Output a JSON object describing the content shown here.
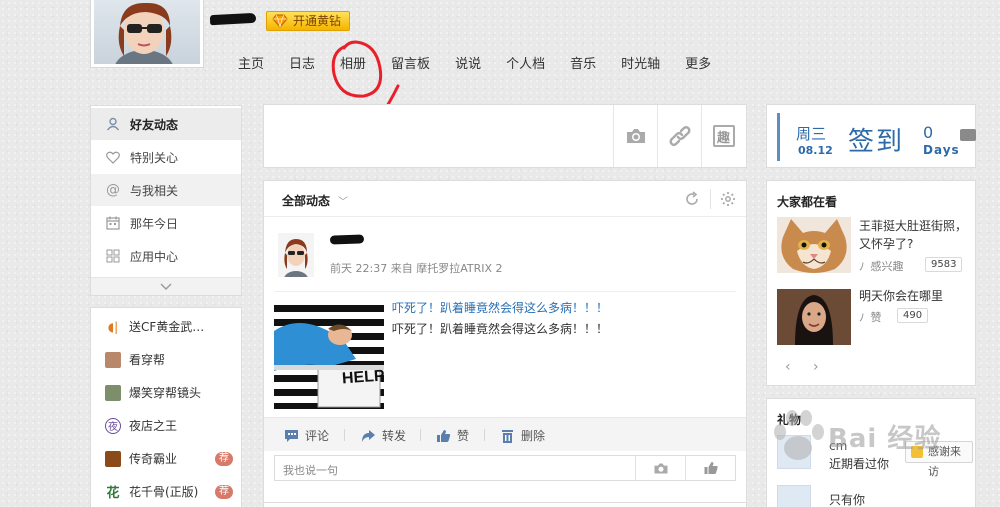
{
  "header": {
    "vip_label": "开通黄钻",
    "nav": [
      "主页",
      "日志",
      "相册",
      "留言板",
      "说说",
      "个人档",
      "音乐",
      "时光轴",
      "更多"
    ]
  },
  "sidebar": {
    "items": [
      {
        "label": "好友动态",
        "icon": "user-icon"
      },
      {
        "label": "特别关心",
        "icon": "heart-icon"
      },
      {
        "label": "与我相关",
        "icon": "at-icon"
      },
      {
        "label": "那年今日",
        "icon": "calendar-icon"
      },
      {
        "label": "应用中心",
        "icon": "grid-icon"
      }
    ],
    "apps": [
      {
        "label": "送CF黄金武…",
        "icon": "audio-icon",
        "badge": ""
      },
      {
        "label": "看穿帮",
        "icon": "app-avatar-icon",
        "badge": ""
      },
      {
        "label": "爆笑穿帮镜头",
        "icon": "app-photo-icon",
        "badge": ""
      },
      {
        "label": "夜店之王",
        "icon": "nightclub-icon",
        "badge": ""
      },
      {
        "label": "传奇霸业",
        "icon": "legend-icon",
        "badge": "荐"
      },
      {
        "label": "花千骨(正版)",
        "icon": "flower-icon",
        "badge": "荐"
      }
    ]
  },
  "compose": {
    "buttons": [
      "camera-icon",
      "link-icon",
      "fun-icon"
    ],
    "fun_label": "趣"
  },
  "feed": {
    "filter": "全部动态",
    "post": {
      "meta": "前天 22:37 来自 摩托罗拉ATRIX 2",
      "title": "吓死了！趴着睡竟然会得这么多病！！！",
      "summary": "吓死了！趴着睡竟然会得这么多病！！！",
      "image_sign": "HELP"
    },
    "actions": [
      "评论",
      "转发",
      "赞",
      "删除"
    ],
    "comment_placeholder": "我也说一句"
  },
  "signin": {
    "weekday": "周三",
    "date": "08.12",
    "button": "签到",
    "days": "0",
    "days_label": "Days"
  },
  "watching": {
    "title": "大家都在看",
    "items": [
      {
        "text": "王菲挺大肚逛街照，又怀孕了?",
        "category": "感兴趣",
        "count": "9583"
      },
      {
        "text": "明天你会在哪里",
        "category": "赞",
        "count": "490"
      }
    ]
  },
  "gifts": {
    "title": "礼物",
    "rows": [
      {
        "name": "cm",
        "label": "近期看过你",
        "button": "感谢来访"
      },
      {
        "name": "",
        "label": "只有你",
        "button": ""
      }
    ]
  },
  "watermark": {
    "text": "Bai 经验"
  },
  "colors": {
    "accent": "#2c6aa8",
    "annotation": "#e8202a",
    "vip": "#f5b400"
  }
}
